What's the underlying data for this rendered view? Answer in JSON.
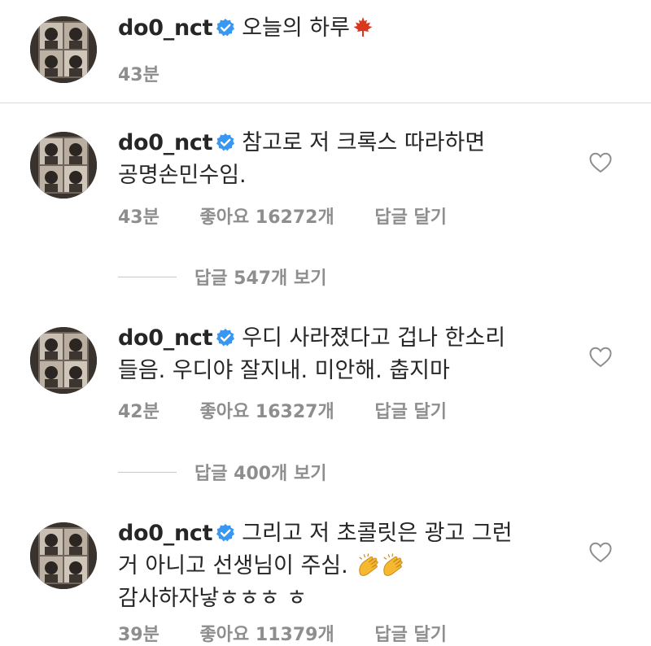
{
  "caption": {
    "username": "do0_nct",
    "text": "오늘의 하루",
    "emoji": "maple-leaf-icon",
    "time": "43분"
  },
  "comments": [
    {
      "username": "do0_nct",
      "lines": [
        "참고로 저 크록스 따라하면",
        "공명손민수임."
      ],
      "time": "43분",
      "likes": "좋아요 16272개",
      "reply": "답글 달기",
      "view_replies": "답글 547개 보기"
    },
    {
      "username": "do0_nct",
      "lines": [
        "우디 사라졌다고 겁나 한소리",
        "들음. 우디야 잘지내. 미안해. 춥지마"
      ],
      "time": "42분",
      "likes": "좋아요 16327개",
      "reply": "답글 달기",
      "view_replies": "답글 400개 보기"
    },
    {
      "username": "do0_nct",
      "lines": [
        "그리고 저 초콜릿은 광고 그런",
        "거 아니고 선생님이 주심.",
        "감사하자낳ㅎㅎㅎ ㅎ"
      ],
      "emoji": "clapping-hands-icon",
      "time": "39분",
      "likes": "좋아요 11379개",
      "reply": "답글 달기"
    }
  ],
  "colors": {
    "text": "#262626",
    "meta": "#8e8e8e",
    "verified": "#3897f0",
    "maple": "#d9381e",
    "clap": "#f5b82e"
  }
}
